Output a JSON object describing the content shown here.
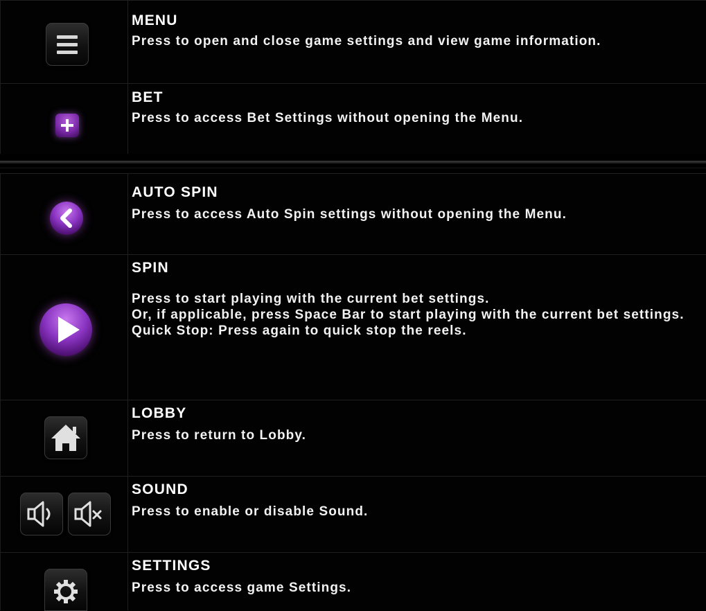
{
  "rows": [
    {
      "id": "menu",
      "title": "MENU",
      "description": "Press to open and close game settings and view game information.",
      "icon": "hamburger-menu-icon"
    },
    {
      "id": "bet",
      "title": "BET",
      "description": "Press to access Bet Settings without opening the Menu.",
      "icon": "plus-icon"
    },
    {
      "id": "auto_spin",
      "title": "AUTO SPIN",
      "description": "Press to access Auto Spin settings without opening the Menu.",
      "icon": "chevron-left-icon"
    },
    {
      "id": "spin",
      "title": "SPIN",
      "description": "Press to start playing with the current bet settings.\nOr, if applicable, press Space Bar to start playing with the current bet settings.\nQuick Stop: Press again to quick stop the reels.",
      "icon": "play-icon"
    },
    {
      "id": "lobby",
      "title": "LOBBY",
      "description": "Press to return to Lobby.",
      "icon": "home-icon"
    },
    {
      "id": "sound",
      "title": "SOUND",
      "description": "Press to enable or disable Sound.",
      "icons": [
        "speaker-on-icon",
        "speaker-muted-icon"
      ]
    },
    {
      "id": "settings",
      "title": "SETTINGS",
      "description": "Press to access game Settings.",
      "icon": "gear-icon"
    }
  ],
  "colors": {
    "background": "#000000",
    "text": "#ffffff",
    "accent_purple": "#8a34c2"
  }
}
